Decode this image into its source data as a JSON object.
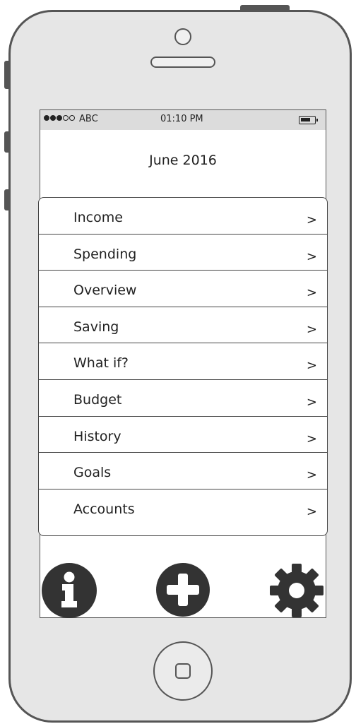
{
  "status_bar": {
    "carrier": "ABC",
    "time": "01:10 PM",
    "signal_bars_filled": 3,
    "signal_bars_total": 5
  },
  "header": {
    "title": "June 2016"
  },
  "menu": {
    "items": [
      {
        "label": "Income",
        "chevron": ">"
      },
      {
        "label": "Spending",
        "chevron": ">"
      },
      {
        "label": "Overview",
        "chevron": ">"
      },
      {
        "label": "Saving",
        "chevron": ">"
      },
      {
        "label": "What if?",
        "chevron": ">"
      },
      {
        "label": "Budget",
        "chevron": ">"
      },
      {
        "label": "History",
        "chevron": ">"
      },
      {
        "label": "Goals",
        "chevron": ">"
      },
      {
        "label": "Accounts",
        "chevron": ">"
      }
    ]
  },
  "toolbar": {
    "icons": [
      "info-icon",
      "add-icon",
      "gear-icon"
    ]
  },
  "colors": {
    "device_frame": "#555555",
    "device_body": "#e6e6e6",
    "status_bar_bg": "#dcdcdc",
    "icon_fill": "#333333"
  }
}
